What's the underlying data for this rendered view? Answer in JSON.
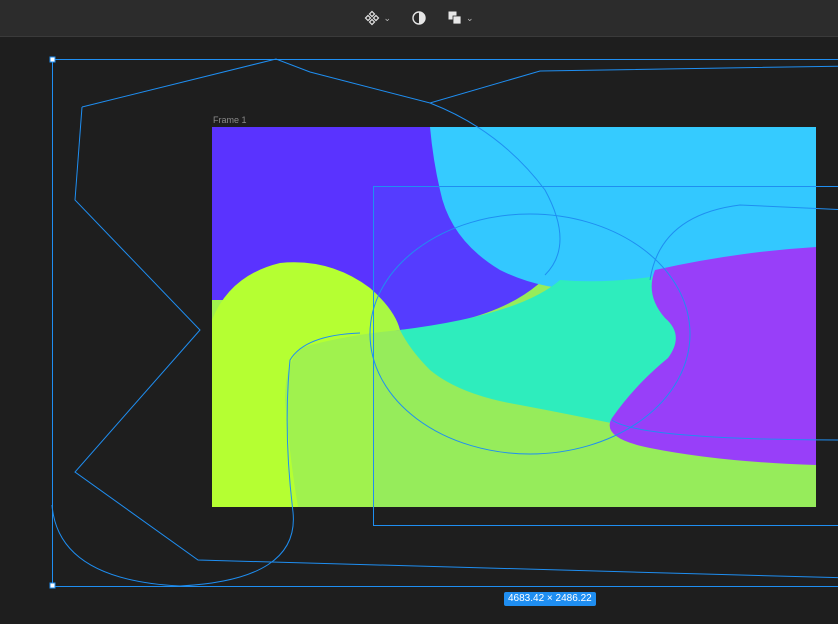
{
  "toolbar": {
    "tools": [
      {
        "name": "component-tool",
        "icon": "component-icon",
        "has_dropdown": true
      },
      {
        "name": "mask-tool",
        "icon": "contrast-icon",
        "has_dropdown": false
      },
      {
        "name": "boolean-tool",
        "icon": "boolean-union-icon",
        "has_dropdown": true
      }
    ]
  },
  "canvas": {
    "frame_label": "Frame 1",
    "dimensions": "4683.42 × 2486.22",
    "colors": {
      "background": "#1e1e1e",
      "selection": "#1f8ef1",
      "violet": "#5a33ff",
      "cyan": "#35cbff",
      "lime": "#b5ff32",
      "mint": "#2ff3b8",
      "purple": "#a237f9",
      "green": "#a0f24e"
    }
  }
}
